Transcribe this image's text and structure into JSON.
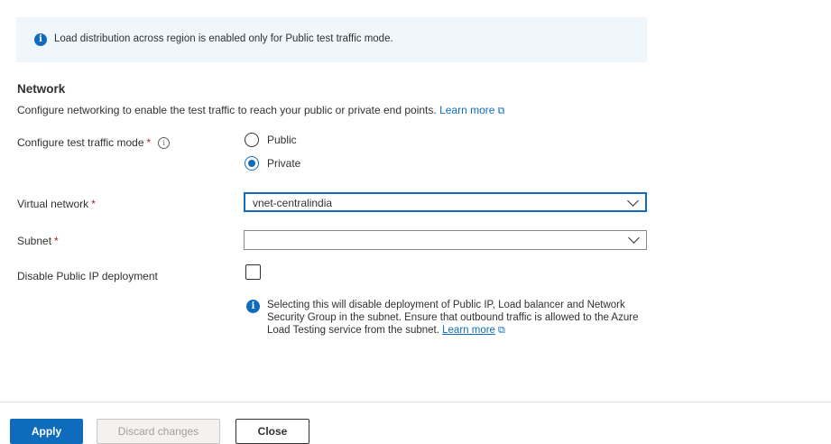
{
  "info_bar": {
    "icon": "info-filled-icon",
    "text": "Load distribution across region is enabled only for Public test traffic mode."
  },
  "network": {
    "title": "Network",
    "description": "Configure networking to enable the test traffic to reach your public or private end points.",
    "learn_more": "Learn more"
  },
  "traffic_mode": {
    "label": "Configure test traffic mode",
    "required_mark": "*",
    "info_glyph": "i",
    "options": [
      {
        "label": "Public",
        "selected": false
      },
      {
        "label": "Private",
        "selected": true
      }
    ]
  },
  "virtual_network": {
    "label": "Virtual network",
    "required_mark": "*",
    "value": "vnet-centralindia"
  },
  "subnet": {
    "label": "Subnet",
    "required_mark": "*",
    "value": ""
  },
  "disable_public_ip": {
    "label": "Disable Public IP deployment",
    "checked": false
  },
  "note": {
    "icon": "info-filled-icon",
    "text": "Selecting this will disable deployment of Public IP, Load balancer and Network Security Group in the subnet. Ensure that outbound traffic is allowed to the Azure Load Testing service from the subnet.",
    "learn_more": "Learn more"
  },
  "footer": {
    "apply_label": "Apply",
    "discard_label": "Discard changes",
    "close_label": "Close"
  },
  "colors": {
    "accent": "#0f6cbd",
    "required": "#a4262c",
    "info_bar_bg": "#eff6fc"
  }
}
